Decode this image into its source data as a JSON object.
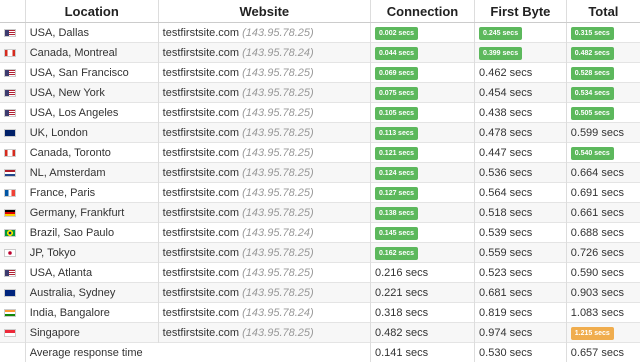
{
  "headers": {
    "location": "Location",
    "website": "Website",
    "connection": "Connection",
    "first_byte": "First Byte",
    "total": "Total"
  },
  "colors": {
    "badge_green": "#5cb85c",
    "badge_orange": "#f0ad4e"
  },
  "rows": [
    {
      "flag": "usa",
      "location": "USA, Dallas",
      "site": "testfirstsite.com",
      "ip": "(143.95.78.25)",
      "connection": "0.002 secs",
      "connection_badge": "green",
      "first_byte": "0.245 secs",
      "first_byte_badge": "green",
      "total": "0.315 secs",
      "total_badge": "green"
    },
    {
      "flag": "canada",
      "location": "Canada, Montreal",
      "site": "testfirstsite.com",
      "ip": "(143.95.78.24)",
      "connection": "0.044 secs",
      "connection_badge": "green",
      "first_byte": "0.399 secs",
      "first_byte_badge": "green",
      "total": "0.482 secs",
      "total_badge": "green"
    },
    {
      "flag": "usa",
      "location": "USA, San Francisco",
      "site": "testfirstsite.com",
      "ip": "(143.95.78.25)",
      "connection": "0.069 secs",
      "connection_badge": "green",
      "first_byte": "0.462 secs",
      "first_byte_badge": "none",
      "total": "0.528 secs",
      "total_badge": "green"
    },
    {
      "flag": "usa",
      "location": "USA, New York",
      "site": "testfirstsite.com",
      "ip": "(143.95.78.25)",
      "connection": "0.075 secs",
      "connection_badge": "green",
      "first_byte": "0.454 secs",
      "first_byte_badge": "none",
      "total": "0.534 secs",
      "total_badge": "green"
    },
    {
      "flag": "usa",
      "location": "USA, Los Angeles",
      "site": "testfirstsite.com",
      "ip": "(143.95.78.25)",
      "connection": "0.105 secs",
      "connection_badge": "green",
      "first_byte": "0.438 secs",
      "first_byte_badge": "none",
      "total": "0.505 secs",
      "total_badge": "green"
    },
    {
      "flag": "uk",
      "location": "UK, London",
      "site": "testfirstsite.com",
      "ip": "(143.95.78.25)",
      "connection": "0.113 secs",
      "connection_badge": "green",
      "first_byte": "0.478 secs",
      "first_byte_badge": "none",
      "total": "0.599 secs",
      "total_badge": "none"
    },
    {
      "flag": "canada",
      "location": "Canada, Toronto",
      "site": "testfirstsite.com",
      "ip": "(143.95.78.25)",
      "connection": "0.121 secs",
      "connection_badge": "green",
      "first_byte": "0.447 secs",
      "first_byte_badge": "none",
      "total": "0.540 secs",
      "total_badge": "green"
    },
    {
      "flag": "nl",
      "location": "NL, Amsterdam",
      "site": "testfirstsite.com",
      "ip": "(143.95.78.25)",
      "connection": "0.124 secs",
      "connection_badge": "green",
      "first_byte": "0.536 secs",
      "first_byte_badge": "none",
      "total": "0.664 secs",
      "total_badge": "none"
    },
    {
      "flag": "france",
      "location": "France, Paris",
      "site": "testfirstsite.com",
      "ip": "(143.95.78.25)",
      "connection": "0.127 secs",
      "connection_badge": "green",
      "first_byte": "0.564 secs",
      "first_byte_badge": "none",
      "total": "0.691 secs",
      "total_badge": "none"
    },
    {
      "flag": "germany",
      "location": "Germany, Frankfurt",
      "site": "testfirstsite.com",
      "ip": "(143.95.78.25)",
      "connection": "0.138 secs",
      "connection_badge": "green",
      "first_byte": "0.518 secs",
      "first_byte_badge": "none",
      "total": "0.661 secs",
      "total_badge": "none"
    },
    {
      "flag": "brazil",
      "location": "Brazil, Sao Paulo",
      "site": "testfirstsite.com",
      "ip": "(143.95.78.24)",
      "connection": "0.145 secs",
      "connection_badge": "green",
      "first_byte": "0.539 secs",
      "first_byte_badge": "none",
      "total": "0.688 secs",
      "total_badge": "none"
    },
    {
      "flag": "japan",
      "location": "JP, Tokyo",
      "site": "testfirstsite.com",
      "ip": "(143.95.78.25)",
      "connection": "0.162 secs",
      "connection_badge": "green",
      "first_byte": "0.559 secs",
      "first_byte_badge": "none",
      "total": "0.726 secs",
      "total_badge": "none"
    },
    {
      "flag": "usa",
      "location": "USA, Atlanta",
      "site": "testfirstsite.com",
      "ip": "(143.95.78.25)",
      "connection": "0.216 secs",
      "connection_badge": "none",
      "first_byte": "0.523 secs",
      "first_byte_badge": "none",
      "total": "0.590 secs",
      "total_badge": "none"
    },
    {
      "flag": "australia",
      "location": "Australia, Sydney",
      "site": "testfirstsite.com",
      "ip": "(143.95.78.25)",
      "connection": "0.221 secs",
      "connection_badge": "none",
      "first_byte": "0.681 secs",
      "first_byte_badge": "none",
      "total": "0.903 secs",
      "total_badge": "none"
    },
    {
      "flag": "india",
      "location": "India, Bangalore",
      "site": "testfirstsite.com",
      "ip": "(143.95.78.24)",
      "connection": "0.318 secs",
      "connection_badge": "none",
      "first_byte": "0.819 secs",
      "first_byte_badge": "none",
      "total": "1.083 secs",
      "total_badge": "none"
    },
    {
      "flag": "singapore",
      "location": "Singapore",
      "site": "testfirstsite.com",
      "ip": "(143.95.78.25)",
      "connection": "0.482 secs",
      "connection_badge": "none",
      "first_byte": "0.974 secs",
      "first_byte_badge": "none",
      "total": "1.215 secs",
      "total_badge": "orange"
    }
  ],
  "average": {
    "label": "Average response time",
    "connection": "0.141 secs",
    "first_byte": "0.530 secs",
    "total": "0.657 secs"
  }
}
